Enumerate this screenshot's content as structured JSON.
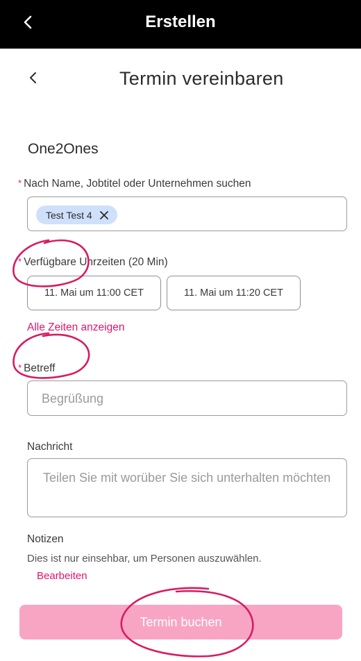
{
  "topbar": {
    "title": "Erstellen",
    "back_icon": "chevron-left-icon"
  },
  "subheader": {
    "title": "Termin vereinbaren",
    "back_icon": "chevron-left-icon"
  },
  "section_title": "One2Ones",
  "required_marker": "*",
  "search": {
    "label": "Nach Name, Jobtitel oder Unternehmen suchen",
    "chip": "Test Test 4",
    "chip_remove_icon": "close-icon"
  },
  "times": {
    "label": "Verfügbare Uhrzeiten (20 Min)",
    "slots": [
      "11. Mai um 11:00 CET",
      "11. Mai um 11:20 CET"
    ],
    "show_all": "Alle Zeiten anzeigen"
  },
  "subject": {
    "label": "Betreff",
    "placeholder": "Begrüßung"
  },
  "message": {
    "label": "Nachricht",
    "placeholder": "Teilen Sie mit worüber Sie sich unterhalten möchten"
  },
  "notes": {
    "label": "Notizen",
    "hint": "Dies ist nur einsehbar, um Personen auszuwählen.",
    "edit": "Bearbeiten"
  },
  "submit": {
    "label": "Termin buchen"
  },
  "colors": {
    "accent": "#e0146b",
    "button": "#f8a5c4",
    "chip": "#cfe0fb",
    "annotation": "#d81b60"
  }
}
